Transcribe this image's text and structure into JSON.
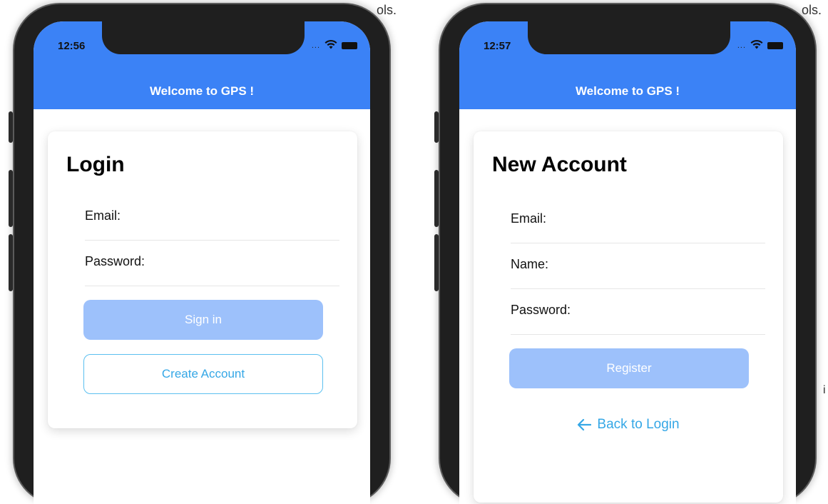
{
  "background": {
    "left_fragment": "ols.",
    "right_fragment": "ols.",
    "right_edge_char": "i"
  },
  "login_screen": {
    "status": {
      "time": "12:56",
      "dots": "..."
    },
    "header_title": "Welcome to GPS !",
    "title": "Login",
    "fields": [
      {
        "label": "Email:",
        "value": ""
      },
      {
        "label": "Password:",
        "value": ""
      }
    ],
    "sign_in_label": "Sign in",
    "create_account_label": "Create Account"
  },
  "register_screen": {
    "status": {
      "time": "12:57",
      "dots": "..."
    },
    "header_title": "Welcome to GPS !",
    "title": "New Account",
    "fields": [
      {
        "label": "Email:",
        "value": ""
      },
      {
        "label": "Name:",
        "value": ""
      },
      {
        "label": "Password:",
        "value": ""
      }
    ],
    "register_label": "Register",
    "back_label": "Back to Login"
  },
  "colors": {
    "header": "#3b82f6",
    "disabled_button": "#9dc1fb",
    "link": "#35a7e6",
    "outline_border": "#5bc0f0"
  }
}
